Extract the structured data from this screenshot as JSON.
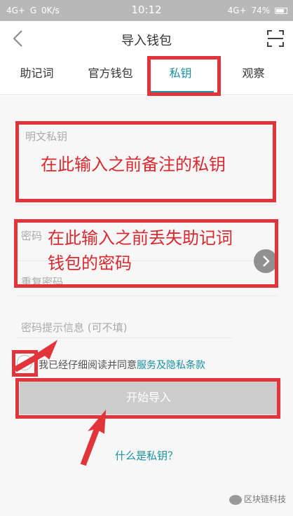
{
  "status_bar": {
    "signal_left": "4G+",
    "signal_mid": "G",
    "net_speed": "0K/s",
    "time": "10:12",
    "battery": "74%",
    "network_right": "4G+"
  },
  "header": {
    "title": "导入钱包",
    "back_icon": "chevron-left-icon",
    "scan_icon": "scan-icon"
  },
  "tabs": [
    {
      "label": "助记词",
      "active": false
    },
    {
      "label": "官方钱包",
      "active": false
    },
    {
      "label": "私钥",
      "active": true
    },
    {
      "label": "观察",
      "active": false
    }
  ],
  "form": {
    "private_key_placeholder": "明文私钥",
    "password_placeholder": "密码",
    "repeat_password_placeholder": "重复密码",
    "password_hint_placeholder": "密码提示信息 (可不填)",
    "agree_prefix": "我已经仔细阅读并同意",
    "agree_link": "服务及隐私条款",
    "import_button": "开始导入",
    "help_link": "什么是私钥？"
  },
  "annotations": {
    "private_key_note": "在此输入之前备注的私钥",
    "password_note_line1": "在此输入之前丢失助记词",
    "password_note_line2": "钱包的密码"
  },
  "watermark": "区块链科技",
  "colors": {
    "accent": "#1a8fa0",
    "annotation_red": "#e1353b",
    "button_disabled": "#cccccc"
  }
}
